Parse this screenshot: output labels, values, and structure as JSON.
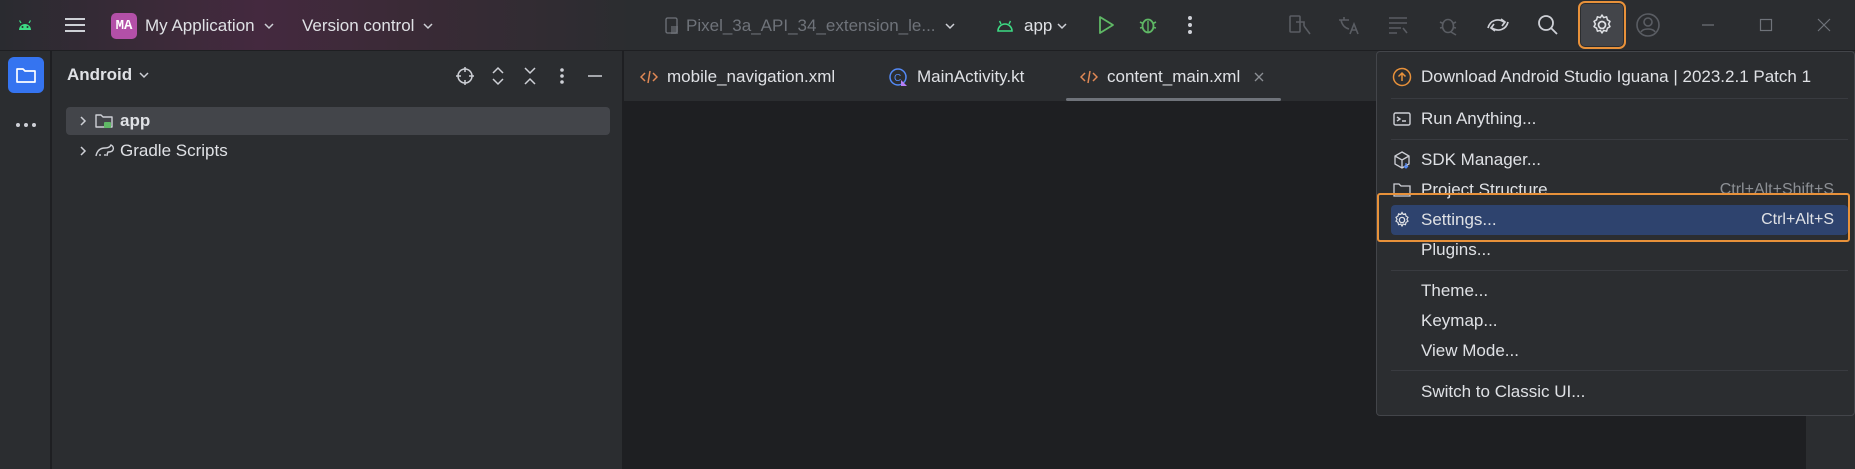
{
  "titlebar": {
    "project_badge": "MA",
    "project_name": "My Application",
    "vcs_label": "Version control",
    "device_label": "Pixel_3a_API_34_extension_le...",
    "run_config": "app"
  },
  "project_panel": {
    "title": "Android",
    "items": [
      {
        "label": "app"
      },
      {
        "label": "Gradle Scripts"
      }
    ]
  },
  "tabs": [
    {
      "label": "mobile_navigation.xml"
    },
    {
      "label": "MainActivity.kt"
    },
    {
      "label": "content_main.xml"
    }
  ],
  "menu": {
    "items": [
      {
        "label": "Download Android Studio Iguana | 2023.2.1 Patch 1",
        "shortcut": ""
      },
      {
        "label": "Run Anything...",
        "shortcut": ""
      },
      {
        "label": "SDK Manager...",
        "shortcut": ""
      },
      {
        "label": "Project Structure...",
        "shortcut": "Ctrl+Alt+Shift+S"
      },
      {
        "label": "Settings...",
        "shortcut": "Ctrl+Alt+S"
      },
      {
        "label": "Plugins...",
        "shortcut": ""
      },
      {
        "label": "Theme...",
        "shortcut": ""
      },
      {
        "label": "Keymap...",
        "shortcut": ""
      },
      {
        "label": "View Mode...",
        "shortcut": ""
      },
      {
        "label": "Switch to Classic UI...",
        "shortcut": ""
      }
    ]
  },
  "colors": {
    "accent_highlight": "#e8913a",
    "selection": "#2e436e",
    "run_green": "#5fb865",
    "android_green": "#3ddc84"
  }
}
